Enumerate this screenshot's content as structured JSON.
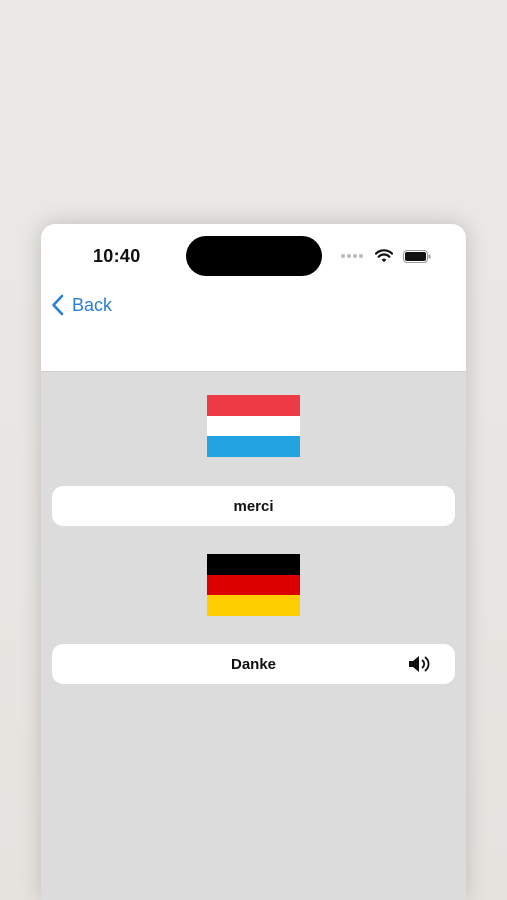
{
  "status_bar": {
    "time": "10:40"
  },
  "nav": {
    "back_label": "Back"
  },
  "source": {
    "flag_name": "luxembourg-flag",
    "flag_colors": [
      "#ee3a44",
      "#ffffff",
      "#24a3e3"
    ],
    "word": "merci"
  },
  "target": {
    "flag_name": "germany-flag",
    "flag_colors": [
      "#000000",
      "#dd0000",
      "#ffce00"
    ],
    "word": "Danke",
    "speaker_icon": "speaker-icon"
  },
  "colors": {
    "accent": "#2a7fd4",
    "content_background": "#dcdcdc",
    "card_background": "#ffffff"
  }
}
